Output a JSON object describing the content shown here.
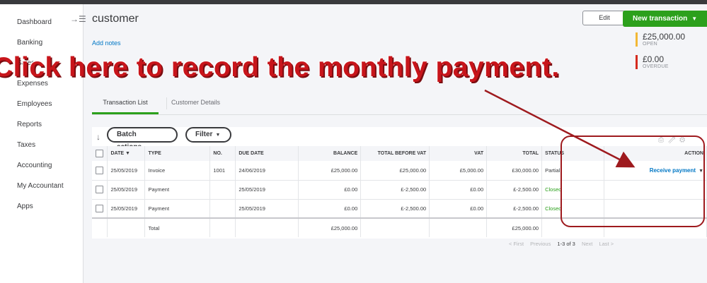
{
  "sidebar": {
    "collapse_icon": "collapse-icon",
    "items": [
      "Dashboard",
      "Banking",
      "Sales",
      "Expenses",
      "Employees",
      "Reports",
      "Taxes",
      "Accounting",
      "My Accountant",
      "Apps"
    ]
  },
  "header": {
    "title": "customer",
    "add_notes": "Add notes",
    "edit_label": "Edit",
    "new_transaction_label": "New transaction"
  },
  "summary": {
    "open_amount": "£25,000.00",
    "open_label": "OPEN",
    "overdue_amount": "£0.00",
    "overdue_label": "OVERDUE",
    "open_color": "#f2b835",
    "overdue_color": "#d52b1e"
  },
  "annotation": {
    "text": "Click here to record the monthly payment.",
    "color": "#c8151b"
  },
  "tabs": [
    "Transaction List",
    "Customer Details"
  ],
  "toolbar": {
    "batch_actions": "Batch actions",
    "filter": "Filter"
  },
  "table": {
    "headers": [
      "DATE ▼",
      "TYPE",
      "NO.",
      "DUE DATE",
      "BALANCE",
      "TOTAL BEFORE VAT",
      "VAT",
      "TOTAL",
      "STATUS",
      "ACTION"
    ],
    "rows": [
      {
        "date": "25/05/2019",
        "type": "Invoice",
        "no": "1001",
        "due": "24/06/2019",
        "balance": "£25,000.00",
        "before_vat": "£25,000.00",
        "vat": "£5,000.00",
        "total": "£30,000.00",
        "status": "Partial",
        "action": "Receive payment"
      },
      {
        "date": "25/05/2019",
        "type": "Payment",
        "no": "",
        "due": "25/05/2019",
        "balance": "£0.00",
        "before_vat": "£-2,500.00",
        "vat": "£0.00",
        "total": "£-2,500.00",
        "status": "Closed",
        "action": ""
      },
      {
        "date": "25/05/2019",
        "type": "Payment",
        "no": "",
        "due": "25/05/2019",
        "balance": "£0.00",
        "before_vat": "£-2,500.00",
        "vat": "£0.00",
        "total": "£-2,500.00",
        "status": "Closed",
        "action": ""
      }
    ],
    "total_row": {
      "label": "Total",
      "balance": "£25,000.00",
      "total": "£25,000.00"
    }
  },
  "pager": {
    "first": "< First",
    "previous": "Previous",
    "info": "1-3 of 3",
    "next": "Next",
    "last": "Last >"
  },
  "colors": {
    "accent_green": "#2ca01c",
    "link_blue": "#0077c5",
    "annotation_red": "#9e1a1e"
  }
}
